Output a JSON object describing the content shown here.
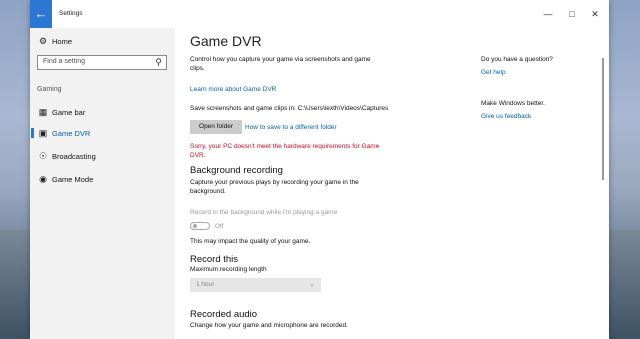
{
  "window": {
    "title": "Settings"
  },
  "sidebar": {
    "home": "Home",
    "search_placeholder": "Find a setting",
    "section": "Gaming",
    "items": [
      {
        "label": "Game bar",
        "icon": "game-bar-icon"
      },
      {
        "label": "Game DVR",
        "icon": "game-dvr-icon"
      },
      {
        "label": "Broadcasting",
        "icon": "broadcast-icon"
      },
      {
        "label": "Game Mode",
        "icon": "game-mode-icon"
      }
    ]
  },
  "main": {
    "title": "Game DVR",
    "desc_line1": "Control how you capture your game via screenshots and game",
    "desc_line2": "clips.",
    "learn_more": "Learn more about Game DVR",
    "save_path": "Save screenshots and game clips in: C:\\Users\\lexth\\Videos\\Captures",
    "open_folder": "Open folder",
    "save_link": "How to save to a different folder",
    "error_line1": "Sorry, your PC doesn't meet the hardware requirements for Game",
    "error_line2": "DVR.",
    "bg_title": "Background recording",
    "bg_desc1": "Capture your previous plays by recording your game in the",
    "bg_desc2": "background.",
    "bg_toggle_label": "Record in the background while I'm playing a game",
    "bg_toggle_state": "Off",
    "bg_note": "This may impact the quality of your game.",
    "record_title": "Record this",
    "max_len_label": "Maximum recording length",
    "max_len_value": "1 hour",
    "audio_title": "Recorded audio",
    "audio_desc": "Change how your game and microphone are recorded."
  },
  "aside": {
    "question": "Do you have a question?",
    "help": "Get help",
    "better": "Make Windows better.",
    "feedback": "Give us feedback"
  }
}
